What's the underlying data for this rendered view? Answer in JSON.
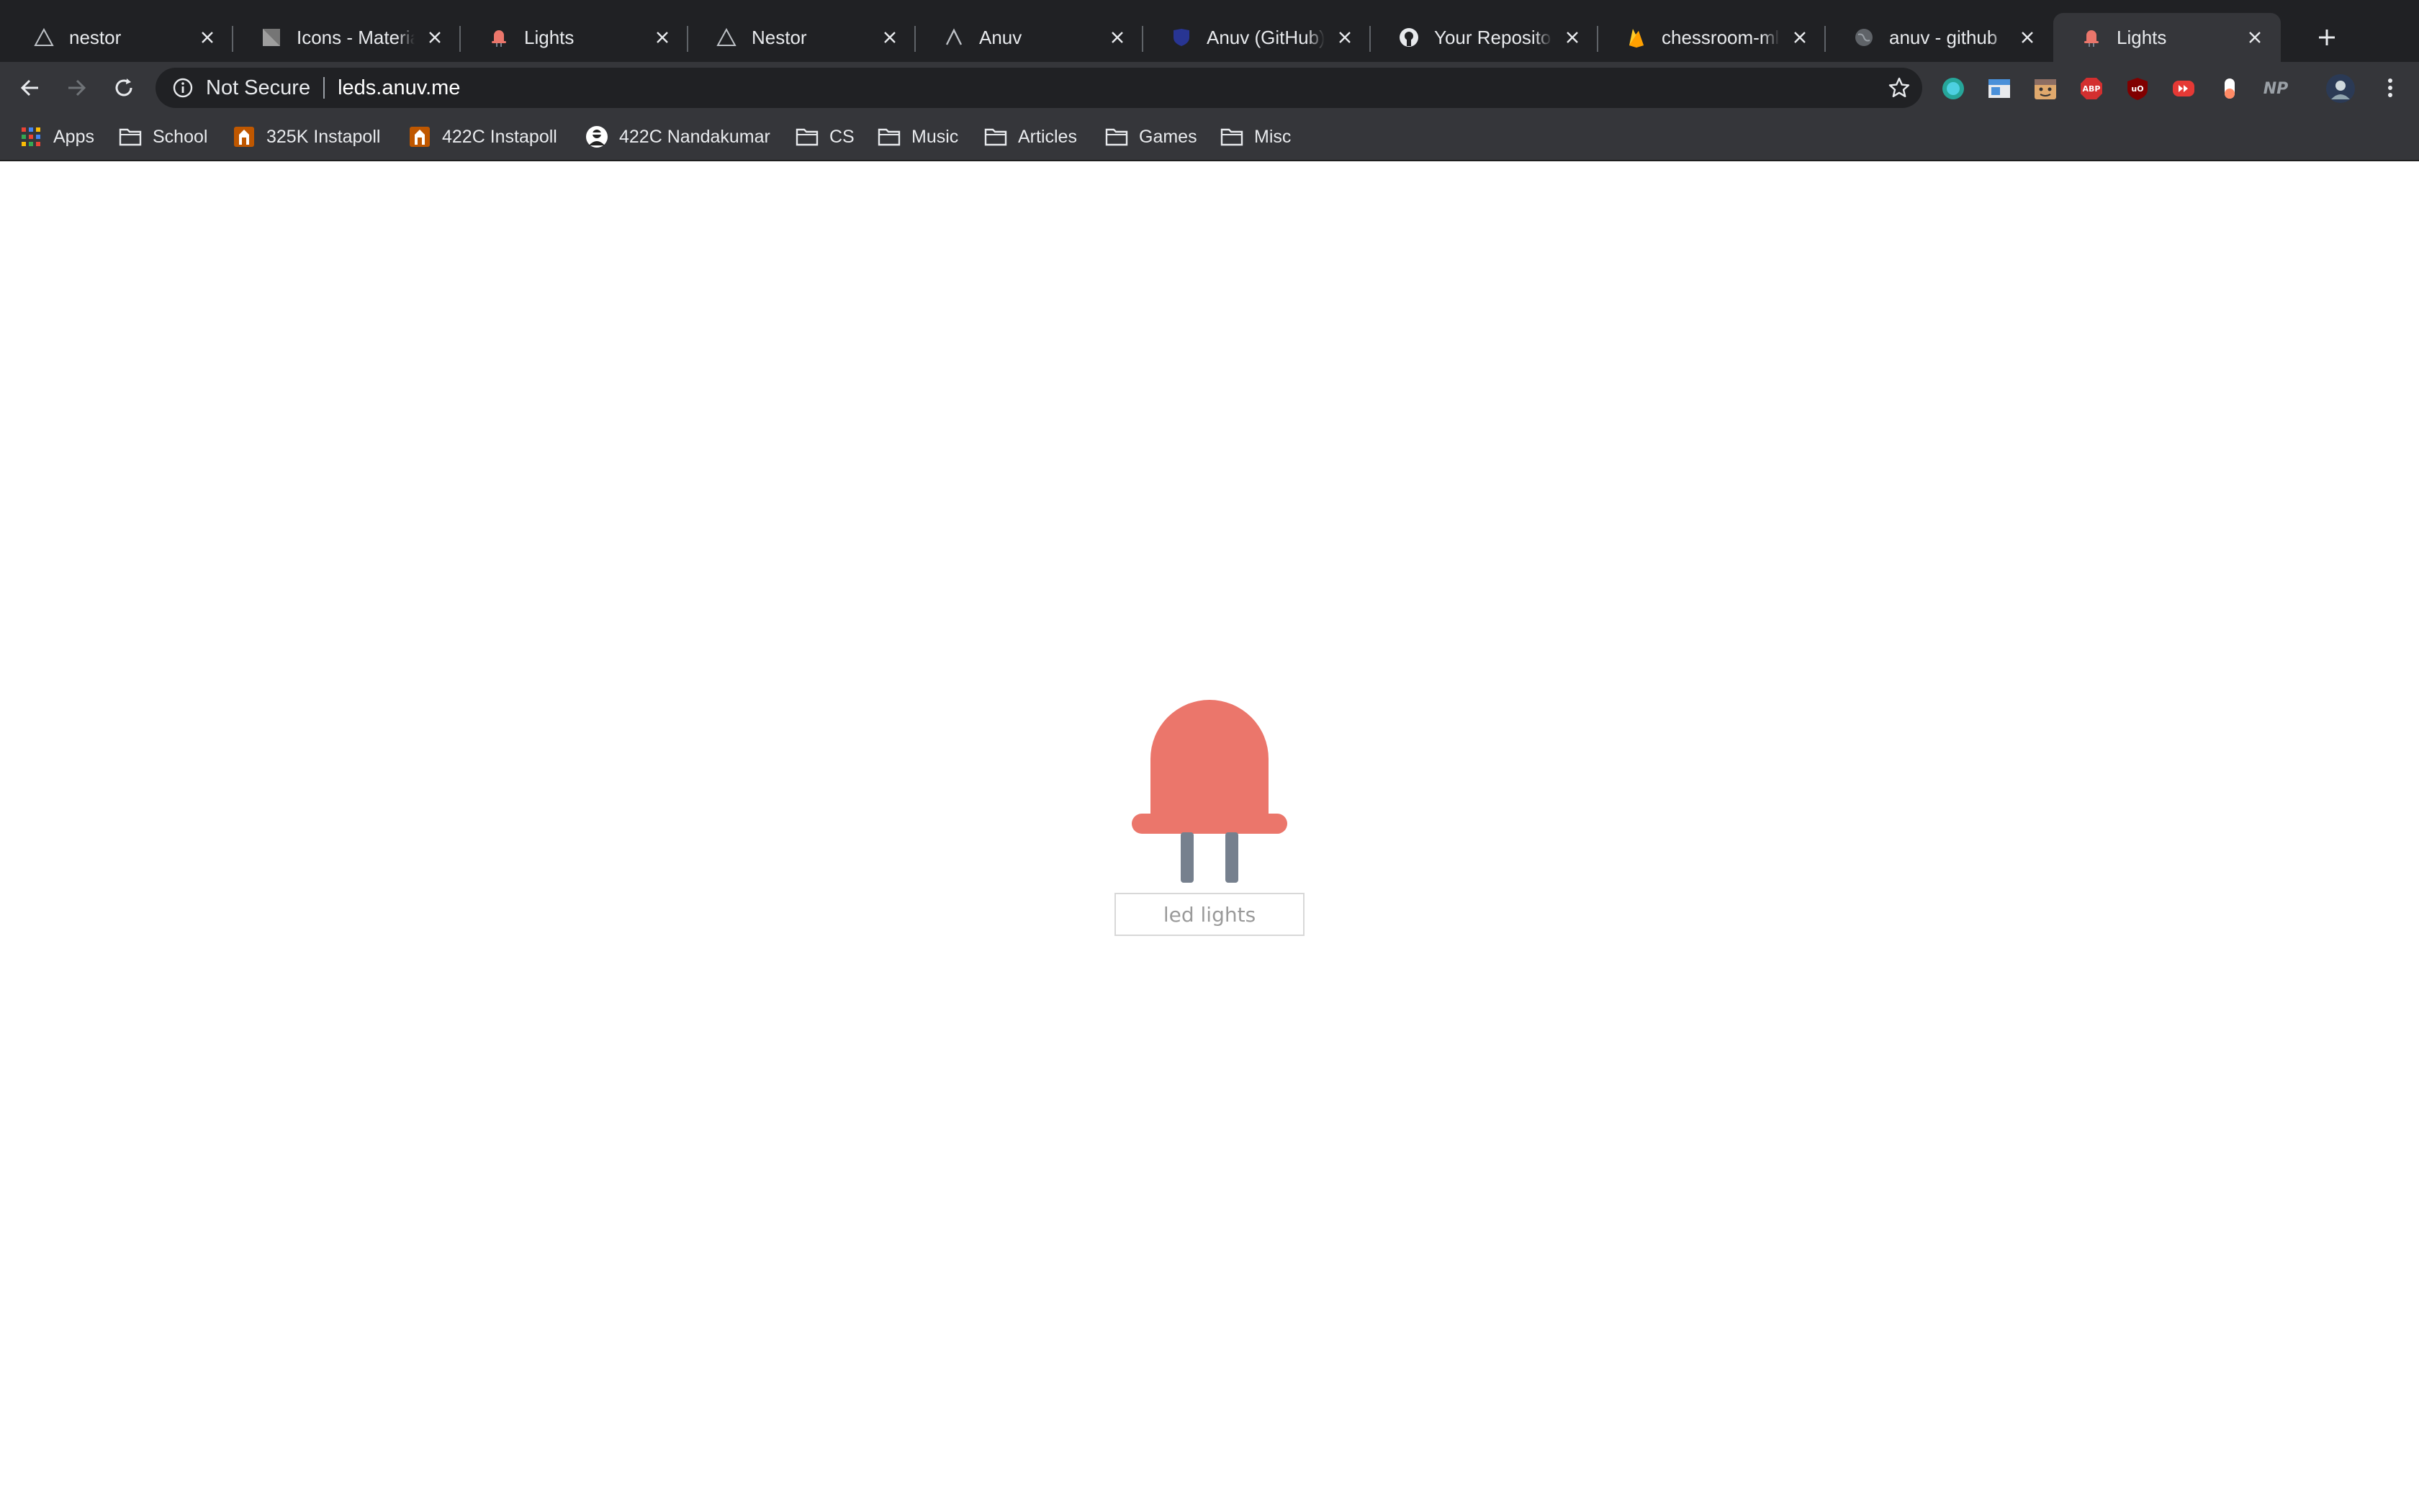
{
  "browser": {
    "tabs": [
      {
        "title": "nestor",
        "favicon": "triangle-icon",
        "active": false
      },
      {
        "title": "Icons - Material Design",
        "favicon": "material-icon",
        "active": false
      },
      {
        "title": "Lights",
        "favicon": "bulb-icon",
        "active": false
      },
      {
        "title": "Nestor",
        "favicon": "triangle-icon",
        "active": false
      },
      {
        "title": "Anuv",
        "favicon": "caret-icon",
        "active": false
      },
      {
        "title": "Anuv (GitHub)",
        "favicon": "shield-icon",
        "active": false
      },
      {
        "title": "Your Repositories",
        "favicon": "github-icon",
        "active": false
      },
      {
        "title": "chessroom-ml – ",
        "favicon": "firebase-icon",
        "active": false
      },
      {
        "title": "anuv - github",
        "favicon": "globe-icon",
        "active": false
      },
      {
        "title": "Lights",
        "favicon": "bulb-icon",
        "active": true
      }
    ],
    "omnibox": {
      "security_label": "Not Secure",
      "url": "leds.anuv.me"
    },
    "extensions": [
      {
        "name": "teal-circle-icon",
        "color": "#26a69a"
      },
      {
        "name": "window-icon",
        "color": "#4a90d9"
      },
      {
        "name": "face-icon",
        "color": "#e0a96d"
      },
      {
        "name": "adblock-icon",
        "label": "ABP",
        "color": "#d32f2f"
      },
      {
        "name": "ublock-icon",
        "label": "uO",
        "color": "#800000"
      },
      {
        "name": "redirect-icon",
        "color": "#e53935"
      },
      {
        "name": "capsule-icon",
        "color": "#ff8a65"
      },
      {
        "name": "np-icon",
        "label": "NP",
        "color": "#9aa0a6"
      }
    ],
    "bookmarks": [
      {
        "label": "Apps",
        "icon": "apps-grid-icon"
      },
      {
        "label": "School",
        "icon": "folder-icon"
      },
      {
        "label": "325K Instapoll",
        "icon": "instapoll-icon"
      },
      {
        "label": "422C Instapoll",
        "icon": "instapoll-icon"
      },
      {
        "label": "422C Nandakumar",
        "icon": "person-icon"
      },
      {
        "label": "CS",
        "icon": "folder-icon"
      },
      {
        "label": "Music",
        "icon": "folder-icon"
      },
      {
        "label": "Articles",
        "icon": "folder-icon"
      },
      {
        "label": "Games",
        "icon": "folder-icon"
      },
      {
        "label": "Misc",
        "icon": "folder-icon"
      }
    ]
  },
  "page": {
    "input_placeholder": "led lights",
    "led_color": "#eb766b",
    "leg_color": "#76808e"
  }
}
